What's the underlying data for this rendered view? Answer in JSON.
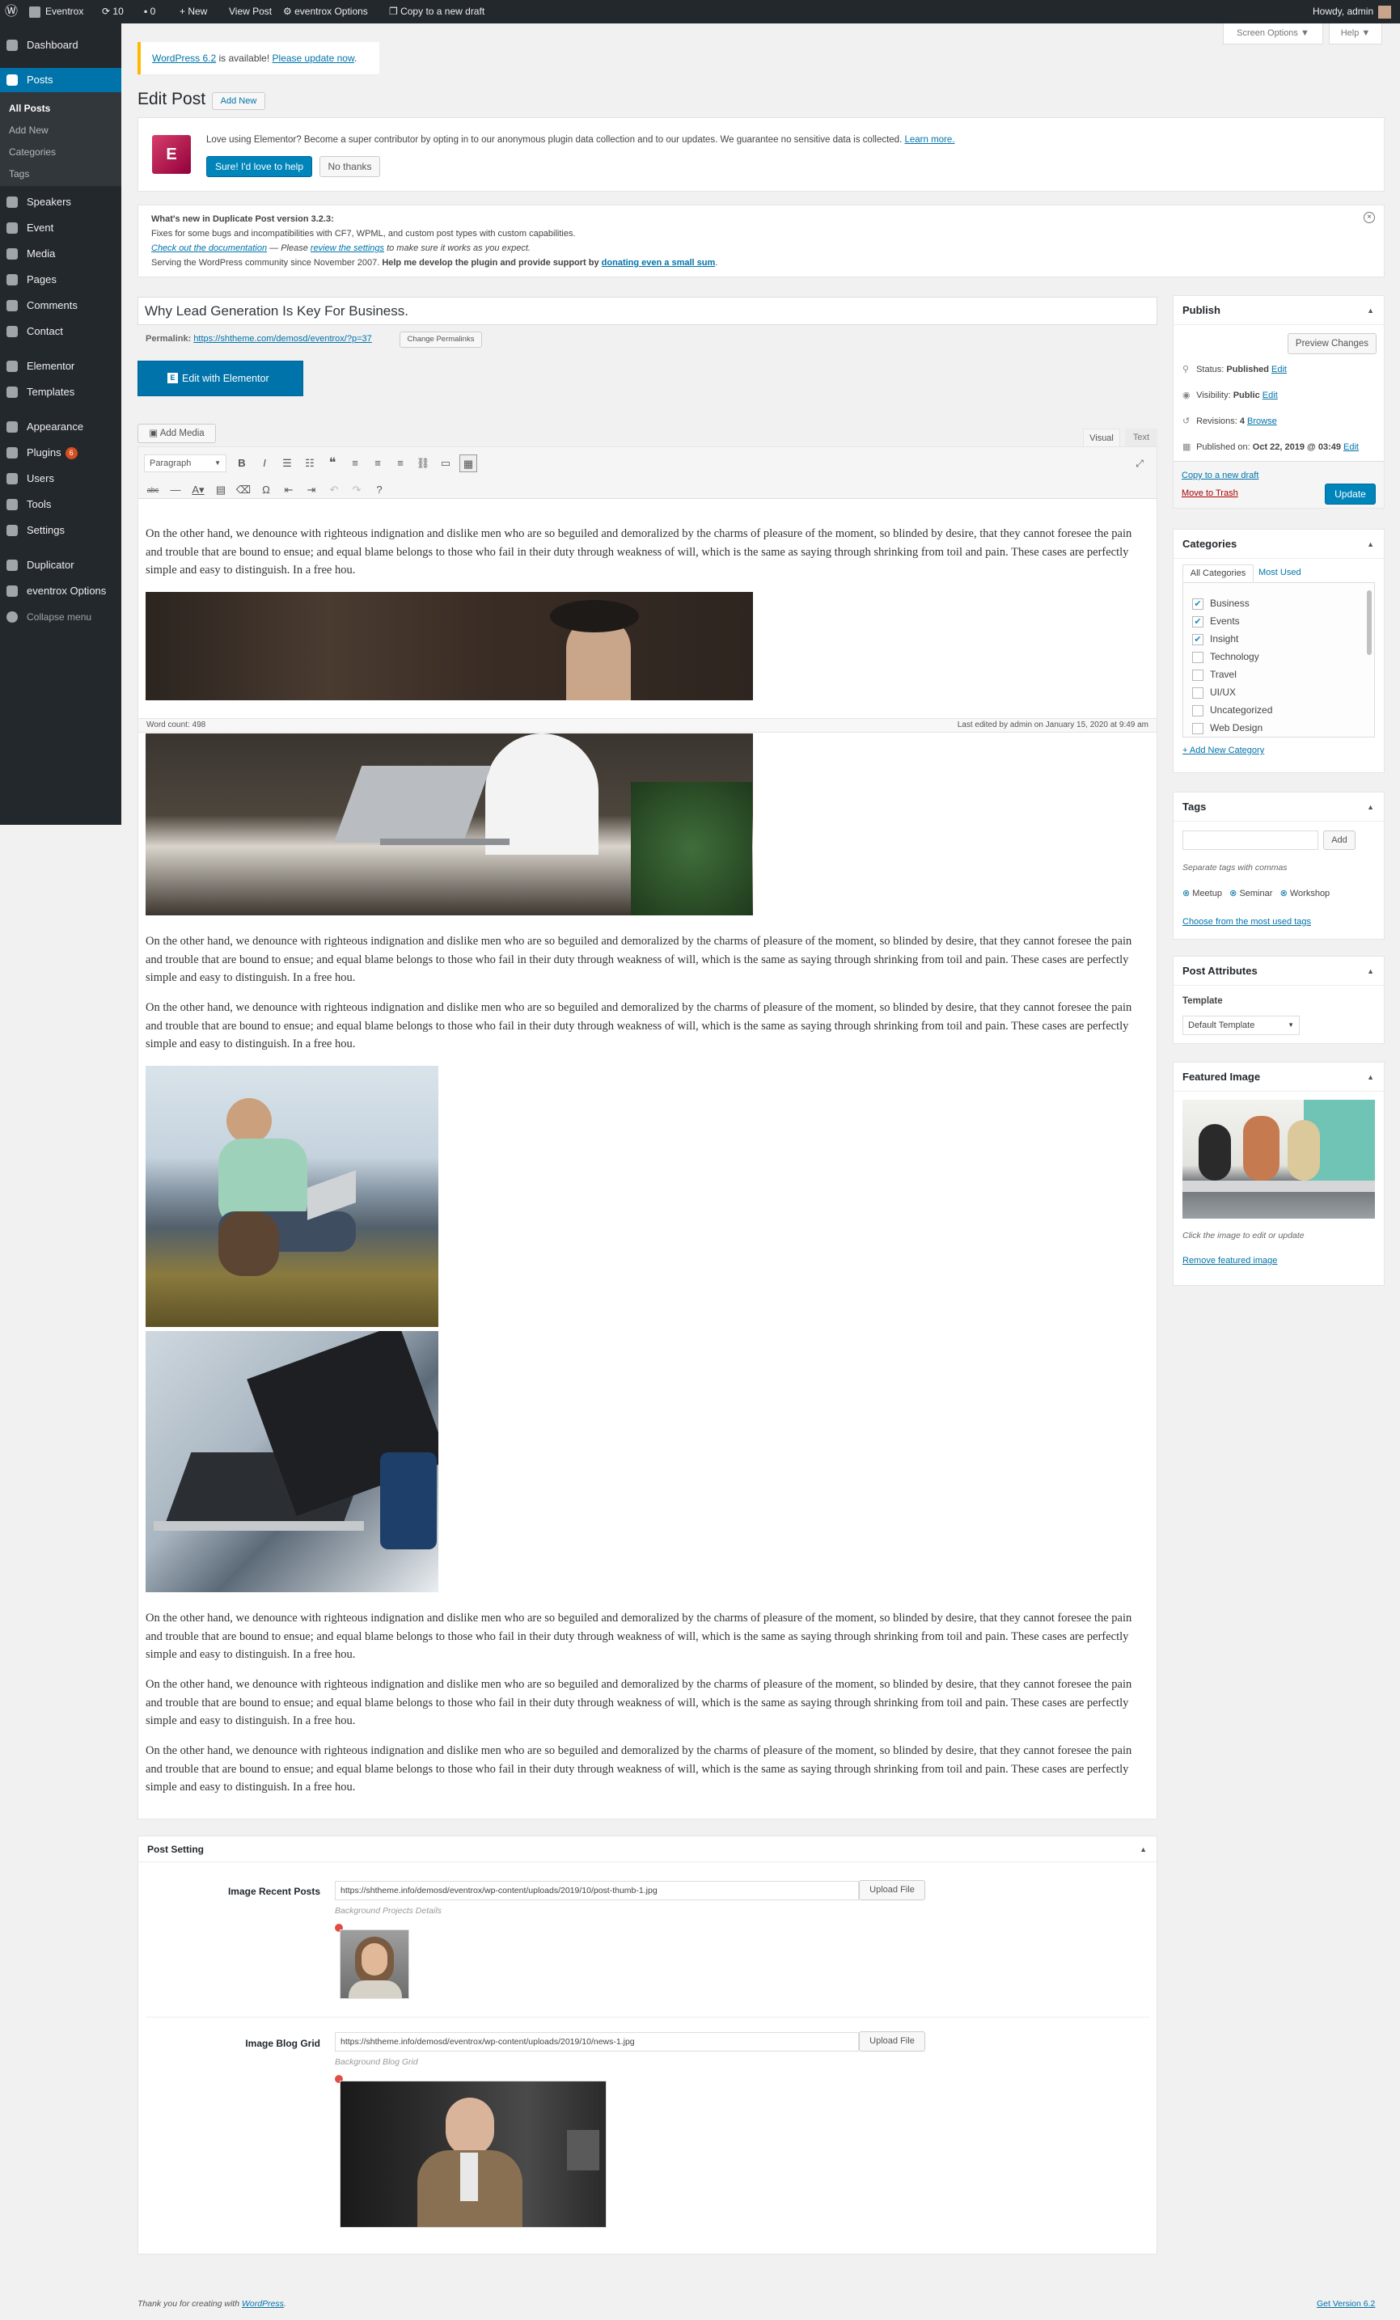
{
  "adminbar": {
    "site_name": "Eventrox",
    "updates_count": "10",
    "comments_count": "0",
    "new_label": "New",
    "view_post": "View Post",
    "theme_options": "eventrox Options",
    "copy_draft": "Copy to a new draft",
    "howdy": "Howdy, admin"
  },
  "screen_options": "Screen Options ▼",
  "help": "Help ▼",
  "sidebar": {
    "items": [
      {
        "label": "Dashboard"
      },
      {
        "label": "Posts"
      },
      {
        "label": "Speakers"
      },
      {
        "label": "Event"
      },
      {
        "label": "Media"
      },
      {
        "label": "Pages"
      },
      {
        "label": "Comments"
      },
      {
        "label": "Contact"
      },
      {
        "label": "Elementor"
      },
      {
        "label": "Templates"
      },
      {
        "label": "Appearance"
      },
      {
        "label": "Plugins",
        "badge": "6"
      },
      {
        "label": "Users"
      },
      {
        "label": "Tools"
      },
      {
        "label": "Settings"
      },
      {
        "label": "Duplicator"
      },
      {
        "label": "eventrox Options"
      },
      {
        "label": "Collapse menu"
      }
    ],
    "posts_sub": [
      "All Posts",
      "Add New",
      "Categories",
      "Tags"
    ]
  },
  "notices": {
    "update_version": "WordPress 6.2",
    "update_text": " is available! ",
    "update_link": "Please update now",
    "update_end": ".",
    "elementor_text": "Love using Elementor? Become a super contributor by opting in to our anonymous plugin data collection and to our updates. We guarantee no sensitive data is collected.",
    "elementor_link": "Learn more.",
    "elementor_yes": "Sure! I'd love to help",
    "elementor_no": "No thanks",
    "dup_title": "What's new in Duplicate Post version 3.2.3:",
    "dup_line1": "Fixes for some bugs and incompatibilities with CF7, WPML, and custom post types with custom capabilities.",
    "dup_link1": "Check out the documentation",
    "dup_mid": " — Please ",
    "dup_link2": "review the settings",
    "dup_end": " to make sure it works as you expect.",
    "dup_line3a": "Serving the WordPress community since November 2007. ",
    "dup_line3b": "Help me develop the plugin and provide support by ",
    "dup_link3": "donating even a small sum",
    "dup_line3c": "."
  },
  "page": {
    "title": "Edit Post",
    "add_new": "Add New",
    "post_title": "Why Lead Generation Is Key For Business.",
    "permalink_label": "Permalink:",
    "permalink_url": "https://shtheme.com/demosd/eventrox/?p=37",
    "change_permalinks": "Change Permalinks",
    "edit_elementor": "Edit with Elementor",
    "add_media": "Add Media",
    "tab_visual": "Visual",
    "tab_text": "Text",
    "format_select": "Paragraph",
    "word_count": "Word count: 498",
    "last_edited": "Last edited by admin on January 15, 2020 at 9:49 am",
    "paragraph": "On the other hand, we denounce with righteous indignation and dislike men who are so beguiled and demoralized by the charms of pleasure of the moment, so blinded by desire, that they cannot foresee the pain and trouble that are bound to ensue; and equal blame belongs to those who fail in their duty through weakness of will, which is the same as saying through shrinking from toil and pain. These cases are perfectly simple and easy to distinguish. In a free hou."
  },
  "publish": {
    "title": "Publish",
    "preview": "Preview Changes",
    "status_label": "Status: ",
    "status": "Published",
    "visibility_label": "Visibility: ",
    "visibility": "Public",
    "revisions_label": "Revisions: ",
    "revisions": "4",
    "browse": "Browse",
    "published_label": "Published on: ",
    "published_on": "Oct 22, 2019 @ 03:49",
    "edit": "Edit",
    "copy_draft": "Copy to a new draft",
    "trash": "Move to Trash",
    "update": "Update"
  },
  "categories": {
    "title": "Categories",
    "tab_all": "All Categories",
    "tab_most": "Most Used",
    "items": [
      {
        "label": "Business",
        "checked": true
      },
      {
        "label": "Events",
        "checked": true
      },
      {
        "label": "Insight",
        "checked": true
      },
      {
        "label": "Technology",
        "checked": false
      },
      {
        "label": "Travel",
        "checked": false
      },
      {
        "label": "UI/UX",
        "checked": false
      },
      {
        "label": "Uncategorized",
        "checked": false
      },
      {
        "label": "Web Design",
        "checked": false
      }
    ],
    "add_new": "+ Add New Category"
  },
  "tags": {
    "title": "Tags",
    "add": "Add",
    "hint": "Separate tags with commas",
    "items": [
      "Meetup",
      "Seminar",
      "Workshop"
    ],
    "choose": "Choose from the most used tags"
  },
  "attributes": {
    "title": "Post Attributes",
    "template_label": "Template",
    "template_value": "Default Template"
  },
  "featured": {
    "title": "Featured Image",
    "hint": "Click the image to edit or update",
    "remove": "Remove featured image"
  },
  "post_setting": {
    "title": "Post Setting",
    "recent_label": "Image Recent Posts",
    "recent_url": "https://shtheme.info/demosd/eventrox/wp-content/uploads/2019/10/post-thumb-1.jpg",
    "recent_desc": "Background Projects Details",
    "grid_label": "Image Blog Grid",
    "grid_url": "https://shtheme.info/demosd/eventrox/wp-content/uploads/2019/10/news-1.jpg",
    "grid_desc": "Background Blog Grid",
    "upload": "Upload File"
  },
  "footer": {
    "thanks": "Thank you for creating with ",
    "wp": "WordPress",
    "dot": ".",
    "version": "Get Version 6.2"
  }
}
